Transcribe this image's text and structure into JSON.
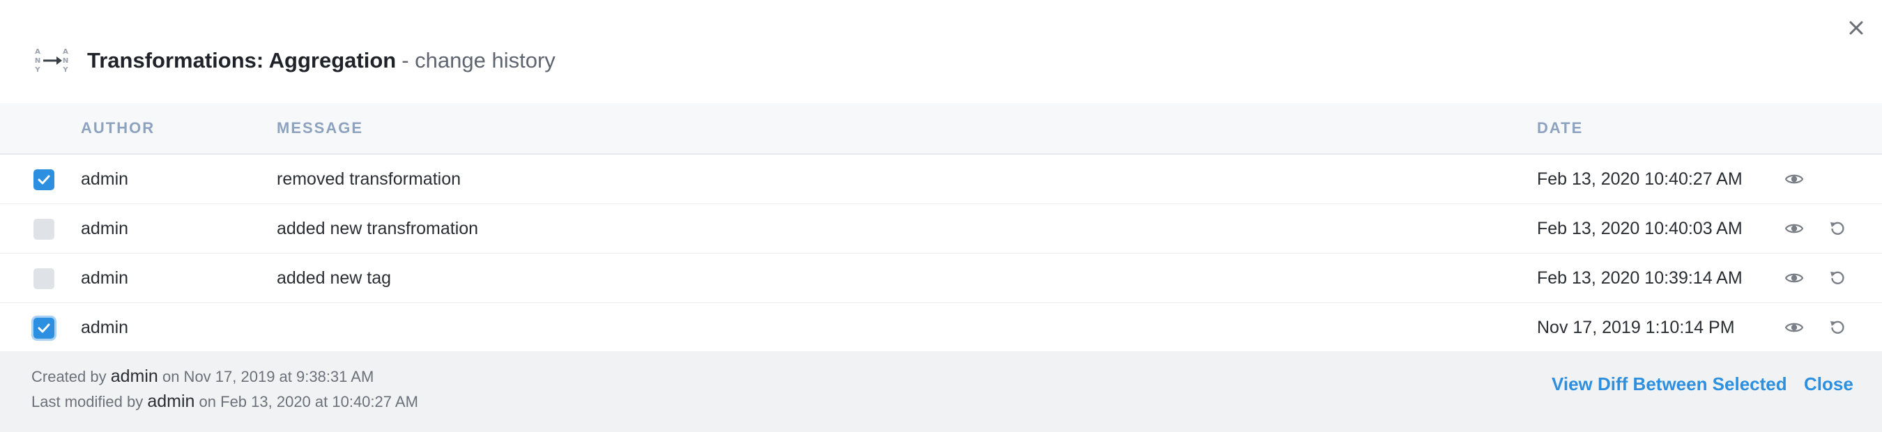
{
  "dialog": {
    "type_icon": "any-to-any-icon",
    "title": "Transformations: Aggregation",
    "subtitle": "- change history",
    "close_icon": "close-icon"
  },
  "table": {
    "columns": {
      "author": "AUTHOR",
      "message": "MESSAGE",
      "date": "DATE"
    },
    "rows": [
      {
        "selected": true,
        "author": "admin",
        "message": "removed transformation",
        "date": "Feb 13, 2020 10:40:27 AM",
        "actions": [
          "eye-icon"
        ]
      },
      {
        "selected": false,
        "author": "admin",
        "message": "added new transfromation",
        "date": "Feb 13, 2020 10:40:03 AM",
        "actions": [
          "eye-icon",
          "revert-icon"
        ]
      },
      {
        "selected": false,
        "author": "admin",
        "message": "added new tag",
        "date": "Feb 13, 2020 10:39:14 AM",
        "actions": [
          "eye-icon",
          "revert-icon"
        ]
      },
      {
        "selected": true,
        "author": "admin",
        "message": "",
        "date": "Nov 17, 2019 1:10:14 PM",
        "actions": [
          "eye-icon",
          "revert-icon"
        ]
      }
    ]
  },
  "footer": {
    "created_prefix": "Created by",
    "created_by": "admin",
    "created_suffix": "on Nov 17, 2019 at 9:38:31 AM",
    "modified_prefix": "Last modified by",
    "modified_by": "admin",
    "modified_suffix": "on Feb 13, 2020 at 10:40:27 AM",
    "diff_label": "View Diff Between Selected",
    "close_label": "Close"
  },
  "colors": {
    "accent": "#2d8fe0",
    "header_text": "#8ca2bf",
    "footer_bg": "#f1f2f4"
  }
}
